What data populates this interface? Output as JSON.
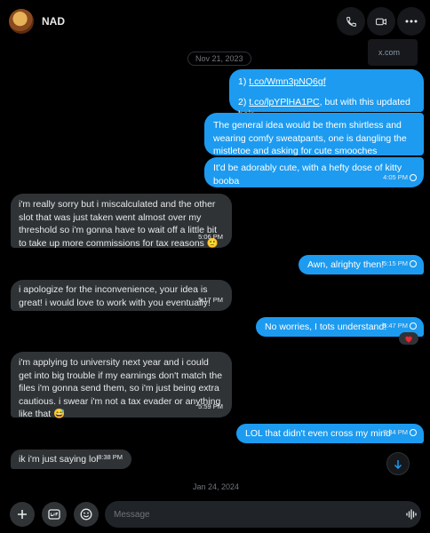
{
  "header": {
    "contact_name": "NAD",
    "icons": [
      "phone-icon",
      "video-icon",
      "more-icon"
    ],
    "popup_text": "x.com"
  },
  "dates": [
    "Nov 21, 2023",
    "Jan 24, 2024"
  ],
  "messages": [
    {
      "dir": "out",
      "line1_prefix": "1) ",
      "line1_link": "t.co/Wmn3pNQ6gf",
      "line2_prefix": "2) ",
      "line2_link": "t.co/lpYPlHA1PC",
      "line2_suffix": ", but with this updated hair"
    },
    {
      "dir": "out",
      "text": "The general idea would be them shirtless and wearing comfy sweatpants, one is dangling the mistletoe and asking for cute smooches"
    },
    {
      "dir": "out",
      "text": "It'd be adorably cute, with a hefty dose of kitty booba",
      "time": "4:05 PM"
    },
    {
      "dir": "in",
      "text": "i'm really sorry but i miscalculated and the other slot that was just taken went almost over my threshold so i'm gonna have to wait off a little bit to take up more commissions for tax reasons 🙂",
      "time": "5:06 PM"
    },
    {
      "dir": "out",
      "text": "Awn, alrighty then!",
      "time": "5:15 PM"
    },
    {
      "dir": "in",
      "text": "i apologize for the inconvenience, your idea is great! i would love to work with you eventually!",
      "time": "5:17 PM"
    },
    {
      "dir": "out",
      "text": "No worries, I tots understand!",
      "time": "5:47 PM",
      "reaction": "❤️"
    },
    {
      "dir": "in",
      "text": "i'm applying to university next year and i could get into big trouble if my earnings don't match the files i'm gonna send them, so i'm just being extra cautious. i swear i'm not a tax evader or anything like that 😅",
      "time": "5:59 PM"
    },
    {
      "dir": "out",
      "text": "LOL that didn't even cross my mind",
      "time": "7:34 PM"
    },
    {
      "dir": "in",
      "text": "ik i'm just saying lol",
      "time": "8:38 PM"
    }
  ],
  "composer": {
    "placeholder": "Message",
    "buttons": [
      "add-icon",
      "gif-icon",
      "emoji-icon",
      "voice-icon"
    ]
  },
  "colors": {
    "outgoing": "#1d9bf0",
    "incoming": "#2f3336",
    "background": "#000000"
  }
}
